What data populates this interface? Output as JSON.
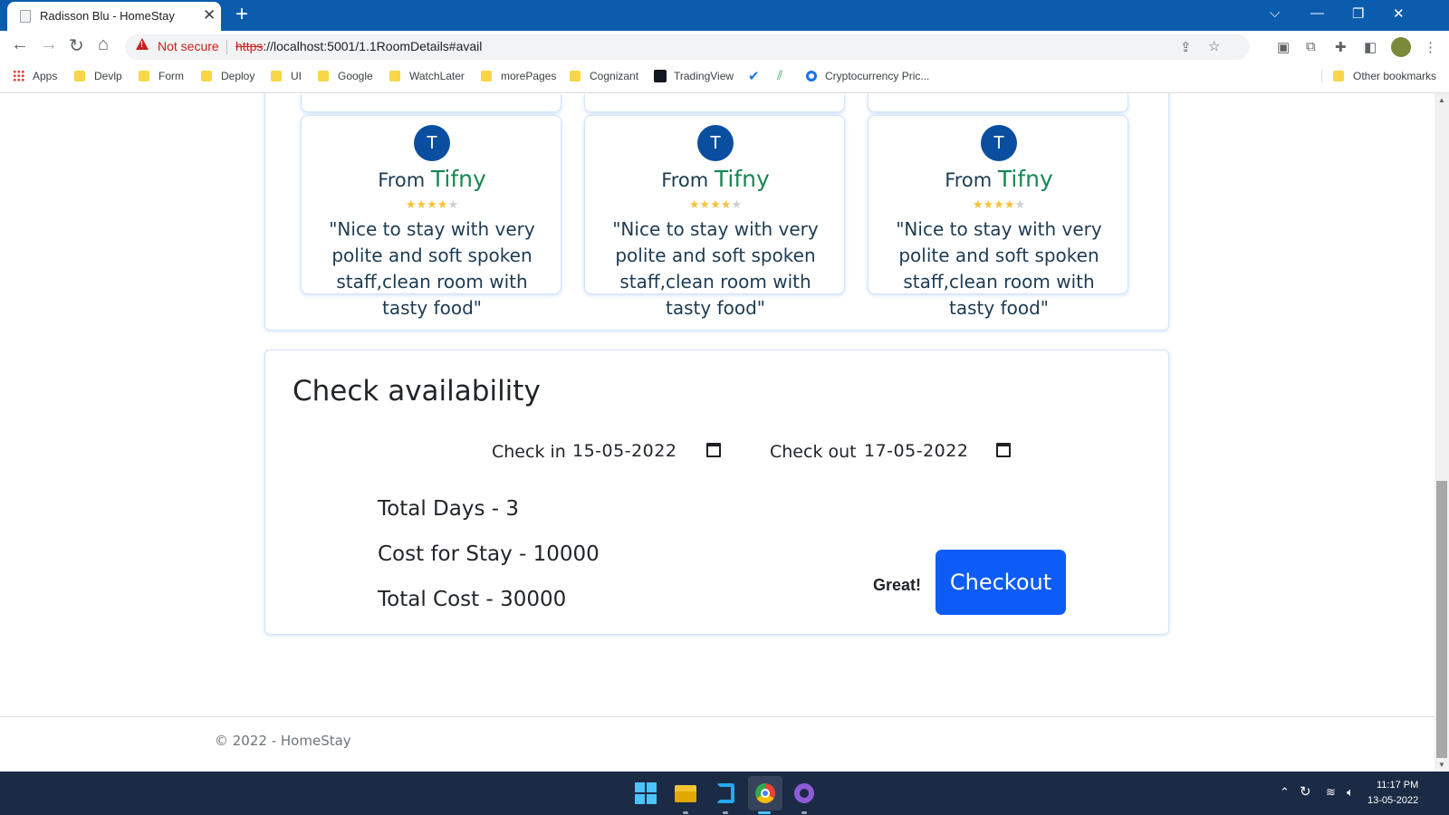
{
  "browser": {
    "tab_title": "Radisson Blu - HomeStay",
    "tab_close": "✕",
    "new_tab": "+",
    "security_label": "Not secure",
    "url_scheme": "https",
    "url_rest": "://localhost:5001/1.1RoomDetails#avail",
    "window_controls": [
      "⌵",
      "—",
      "❐",
      "✕"
    ]
  },
  "bookmarks": {
    "apps": "Apps",
    "items": [
      "Devlp",
      "Form",
      "Deploy",
      "UI",
      "Google",
      "WatchLater",
      "morePages",
      "Cognizant",
      "TradingView",
      "Cryptocurrency Pric..."
    ],
    "other": "Other bookmarks"
  },
  "reviews": [
    {
      "initial": "T",
      "from": "From",
      "name": "Tifny",
      "rating": 4,
      "max": 5,
      "quote": "\"Nice to stay with very polite and soft spoken staff,clean room with tasty food\""
    },
    {
      "initial": "T",
      "from": "From",
      "name": "Tifny",
      "rating": 4,
      "max": 5,
      "quote": "\"Nice to stay with very polite and soft spoken staff,clean room with tasty food\""
    },
    {
      "initial": "T",
      "from": "From",
      "name": "Tifny",
      "rating": 4,
      "max": 5,
      "quote": "\"Nice to stay with very polite and soft spoken staff,clean room with tasty food\""
    }
  ],
  "availability": {
    "title": "Check availability",
    "checkin_label": "Check in",
    "checkin_value": "15-05-2022",
    "checkout_label": "Check out",
    "checkout_value": "17-05-2022",
    "total_days": "Total Days - 3",
    "cost_for_stay": "Cost for Stay - 10000",
    "total_cost": "Total Cost - 30000",
    "great": "Great!",
    "checkout_button": "Checkout"
  },
  "footer": {
    "text": "© 2022 - HomeStay"
  },
  "taskbar": {
    "time": "11:17 PM",
    "date": "13-05-2022"
  },
  "colors": {
    "titlebar": "#0b5cad",
    "accent_green": "#198754",
    "button_blue": "#0d5cf7",
    "avatar_blue": "#0a4ea0",
    "star": "#f6c23e"
  }
}
